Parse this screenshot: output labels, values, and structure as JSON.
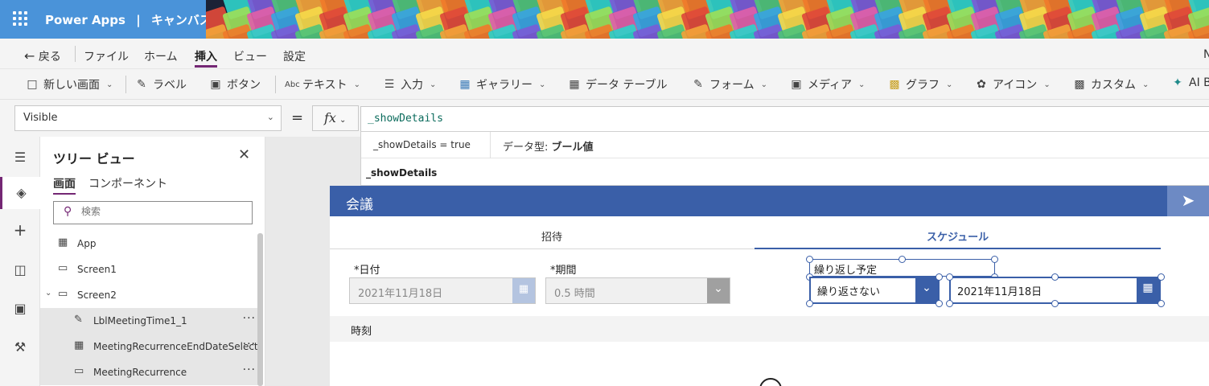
{
  "app": {
    "product": "Power Apps",
    "separator": "|",
    "mode": "キャンバス"
  },
  "menu": {
    "back": "戻る",
    "items": [
      "ファイル",
      "ホーム",
      "挿入",
      "ビュー",
      "設定"
    ],
    "active": "挿入",
    "edge_text": "N"
  },
  "ribbon": {
    "new_screen": "新しい画面",
    "label": "ラベル",
    "button": "ボタン",
    "text": "テキスト",
    "input": "入力",
    "gallery": "ギャラリー",
    "data_table": "データ テーブル",
    "forms": "フォーム",
    "media": "メディア",
    "charts": "グラフ",
    "icons": "アイコン",
    "custom": "カスタム",
    "ai": "AI B"
  },
  "formula": {
    "property": "Visible",
    "equals": "=",
    "fx": "fx",
    "value": "_showDetails",
    "result": "_showDetails  =  true",
    "datatype_label": "データ型:",
    "datatype_value": "ブール値",
    "suggestion": "_showDetails"
  },
  "tree": {
    "title": "ツリー ビュー",
    "tabs": [
      "画面",
      "コンポーネント"
    ],
    "search_placeholder": "検索",
    "nodes": {
      "app": "App",
      "screen1": "Screen1",
      "screen2": "Screen2",
      "lbl_time": "LblMeetingTime1_1",
      "recurrence_end": "MeetingRecurrenceEndDateSelect",
      "recurrence": "MeetingRecurrence"
    }
  },
  "canvas": {
    "header_title": "会議",
    "tabs": [
      "招待",
      "スケジュール"
    ],
    "active_tab": "スケジュール",
    "date_label": "*日付",
    "date_value": "2021年11月18日",
    "duration_label": "*期間",
    "duration_value": "0.5 時間",
    "recurrence_label": "繰り返し予定",
    "recurrence_value": "繰り返さない",
    "recurrence_end_value": "2021年11月18日",
    "time_label": "時刻"
  },
  "colors": {
    "header_blue": "#4a93d9",
    "accent_purple": "#742774",
    "app_blue": "#3a5fa8"
  }
}
